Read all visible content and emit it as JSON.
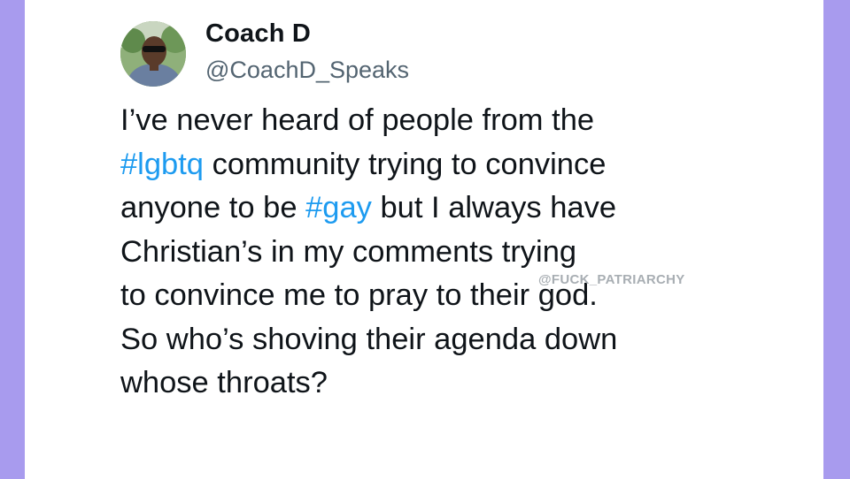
{
  "author": {
    "display_name": "Coach D",
    "handle": "@CoachD_Speaks"
  },
  "tweet": {
    "lines": [
      {
        "segments": [
          {
            "text": "I’ve never heard of people from the",
            "hashtag": false
          }
        ]
      },
      {
        "segments": [
          {
            "text": "#lgbtq",
            "hashtag": true
          },
          {
            "text": " community trying to convince",
            "hashtag": false
          }
        ]
      },
      {
        "segments": [
          {
            "text": "anyone to be ",
            "hashtag": false
          },
          {
            "text": "#gay",
            "hashtag": true
          },
          {
            "text": " but I always have",
            "hashtag": false
          }
        ]
      },
      {
        "segments": [
          {
            "text": "Christian’s in my comments trying",
            "hashtag": false
          }
        ]
      },
      {
        "segments": [
          {
            "text": "to convince me to pray to their god.",
            "hashtag": false
          }
        ]
      },
      {
        "segments": [
          {
            "text": "So who’s shoving their agenda down",
            "hashtag": false
          }
        ]
      },
      {
        "segments": [
          {
            "text": "whose throats?",
            "hashtag": false
          }
        ]
      }
    ]
  },
  "watermark": "@FUCK_PATRIARCHY",
  "colors": {
    "background_border": "#a89bee",
    "card": "#ffffff",
    "text": "#0f1419",
    "handle": "#536471",
    "hashtag": "#1d9bf0"
  },
  "icons": {
    "avatar": "profile-photo"
  }
}
